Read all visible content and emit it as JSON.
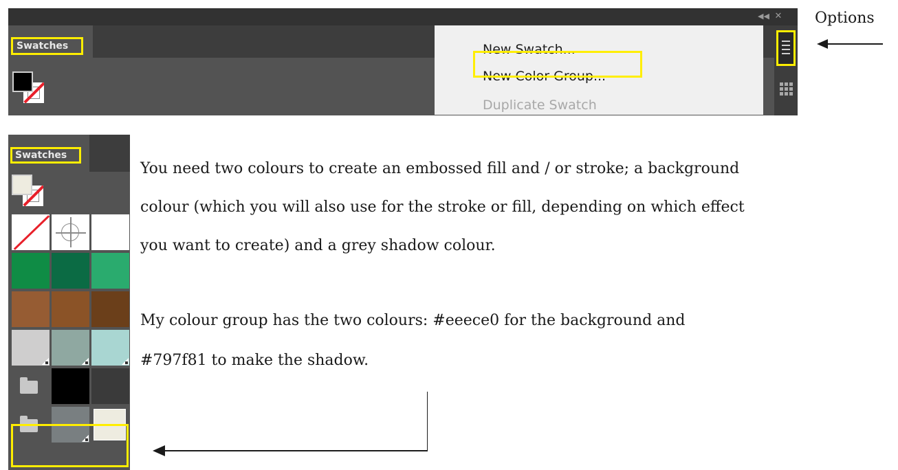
{
  "top_panel": {
    "tab_label": "Swatches",
    "collapse_icon": "double-chevron-left-icon",
    "close_icon": "close-icon",
    "menu_items": [
      {
        "label": "New Swatch...",
        "enabled": true
      },
      {
        "label": "New Color Group...",
        "enabled": true,
        "highlighted": true
      },
      {
        "label": "Duplicate Swatch",
        "enabled": false
      }
    ],
    "options_icon": "hamburger-menu-icon",
    "grid_icon": "grid-view-icon"
  },
  "options_label": "Options",
  "left_panel": {
    "tab_label": "Swatches",
    "fill_color": "#eeece0",
    "swatch_rows": [
      [
        {
          "kind": "none"
        },
        {
          "kind": "registration"
        },
        {
          "kind": "color",
          "color": "#ffffff"
        }
      ],
      [
        {
          "kind": "color",
          "color": "#0f8c45"
        },
        {
          "kind": "color",
          "color": "#0b6b44"
        },
        {
          "kind": "color",
          "color": "#2aab6e"
        }
      ],
      [
        {
          "kind": "color",
          "color": "#965c33"
        },
        {
          "kind": "color",
          "color": "#8b5327"
        },
        {
          "kind": "color",
          "color": "#6b3f1a"
        }
      ],
      [
        {
          "kind": "color",
          "color": "#cfcece",
          "corner": true
        },
        {
          "kind": "color",
          "color": "#8fa8a1",
          "corner": true
        },
        {
          "kind": "color",
          "color": "#a9d6d2",
          "corner": true
        }
      ],
      [
        {
          "kind": "folder"
        },
        {
          "kind": "color",
          "color": "#000000"
        },
        {
          "kind": "color",
          "color": "#3a3a3a"
        }
      ],
      [
        {
          "kind": "folder"
        },
        {
          "kind": "color",
          "color": "#797f81",
          "corner": true
        },
        {
          "kind": "color",
          "color": "#eeece0",
          "selected": true
        }
      ]
    ]
  },
  "body": {
    "paragraph1_lines": [
      "You need two colours to create an embossed fill and  / or stroke; a background",
      "colour (which you will also use for the stroke or fill, depending on which effect",
      "you want to create) and a grey shadow  colour."
    ],
    "paragraph2_lines": [
      "My colour group has the two colours:  #eeece0 for the background and",
      "#797f81 to make the shadow."
    ]
  },
  "colors": {
    "highlight": "#ffee00",
    "panel_bg": "#535353",
    "panel_dark": "#3d3d3d",
    "background_color": "#eeece0",
    "shadow_color": "#797f81"
  }
}
